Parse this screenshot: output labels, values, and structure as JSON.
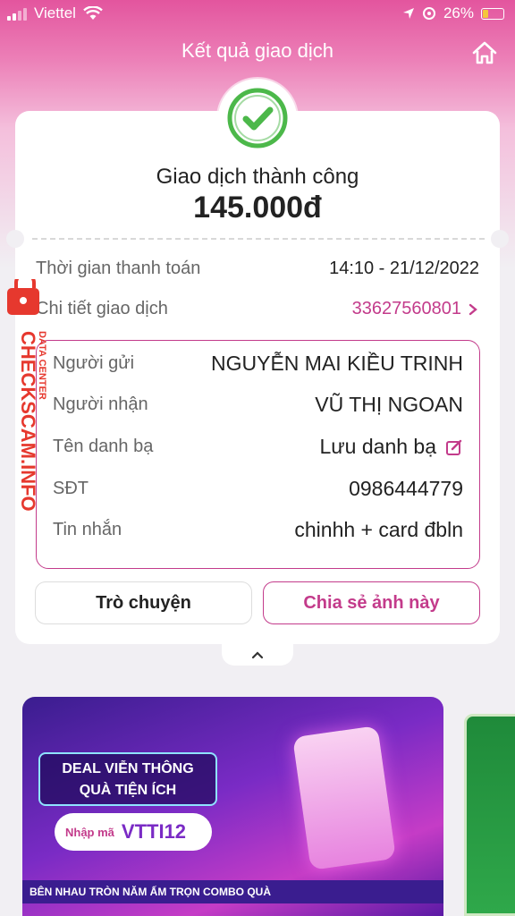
{
  "status_bar": {
    "carrier": "Viettel",
    "battery": "26%",
    "battery_level": 0.26
  },
  "header": {
    "title": "Kết quả giao dịch"
  },
  "result": {
    "status": "Giao dịch thành công",
    "amount": "145.000đ"
  },
  "details": {
    "time_label": "Thời gian thanh toán",
    "time_value": "14:10 - 21/12/2022",
    "detail_label": "Chi tiết giao dịch",
    "detail_value": "33627560801"
  },
  "info": {
    "sender_label": "Người gửi",
    "sender_value": "NGUYỄN MAI KIỀU TRINH",
    "receiver_label": "Người nhận",
    "receiver_value": "VŨ THỊ NGOAN",
    "contact_label": "Tên danh bạ",
    "contact_value": "Lưu danh bạ",
    "phone_label": "SĐT",
    "phone_value": "0986444779",
    "message_label": "Tin nhắn",
    "message_value": "chinhh + card đbln"
  },
  "buttons": {
    "chat": "Trò chuyện",
    "share": "Chia sẻ ảnh này"
  },
  "banner": {
    "deal_line1": "DEAL VIỄN THÔNG",
    "deal_line2": "QUÀ TIỆN ÍCH",
    "promo_prefix": "Nhập mã",
    "promo_code": "VTTI12",
    "footer": "BÊN NHAU TRÒN NĂM ẤM TRỌN COMBO QUÀ"
  },
  "watermark": {
    "main": "CHECKSCAM.INFO",
    "sub": "DATA CENTER"
  },
  "colors": {
    "accent": "#c33b8b",
    "success": "#4cb84a",
    "header_pink": "#e3559e"
  },
  "icons": [
    "wifi-icon",
    "location-icon",
    "alarm-icon",
    "home-icon",
    "check-circle-icon",
    "chevron-right-icon",
    "edit-icon",
    "chevron-up-icon"
  ]
}
